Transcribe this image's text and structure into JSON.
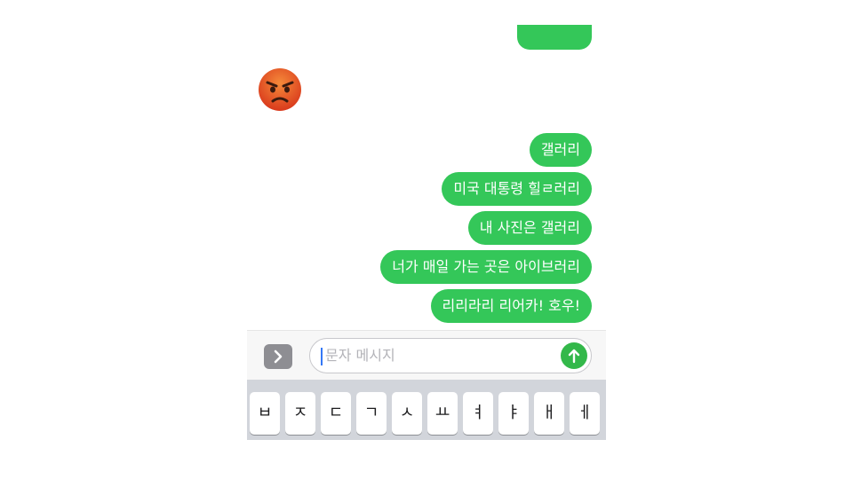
{
  "colors": {
    "bubble_green": "#34c759",
    "send_green": "#33b84a",
    "keyboard_bg": "#d2d5db"
  },
  "chat": {
    "reaction_emoji": "angry-face-icon",
    "messages": [
      {
        "text": "갤러리"
      },
      {
        "text": "미국 대통령 힐ㄹ러리"
      },
      {
        "text": "내 사진은 갤러리"
      },
      {
        "text": "너가 매일 가는 곳은 아이브러리"
      },
      {
        "text": "리리라리 리어카! 호우!"
      }
    ]
  },
  "input_bar": {
    "apps_icon": "chevron-right-icon",
    "placeholder": "문자 메시지",
    "send_icon": "arrow-up-icon"
  },
  "keyboard": {
    "keys": [
      "ㅂ",
      "ㅈ",
      "ㄷ",
      "ㄱ",
      "ㅅ",
      "ㅛ",
      "ㅕ",
      "ㅑ",
      "ㅐ",
      "ㅔ"
    ]
  }
}
